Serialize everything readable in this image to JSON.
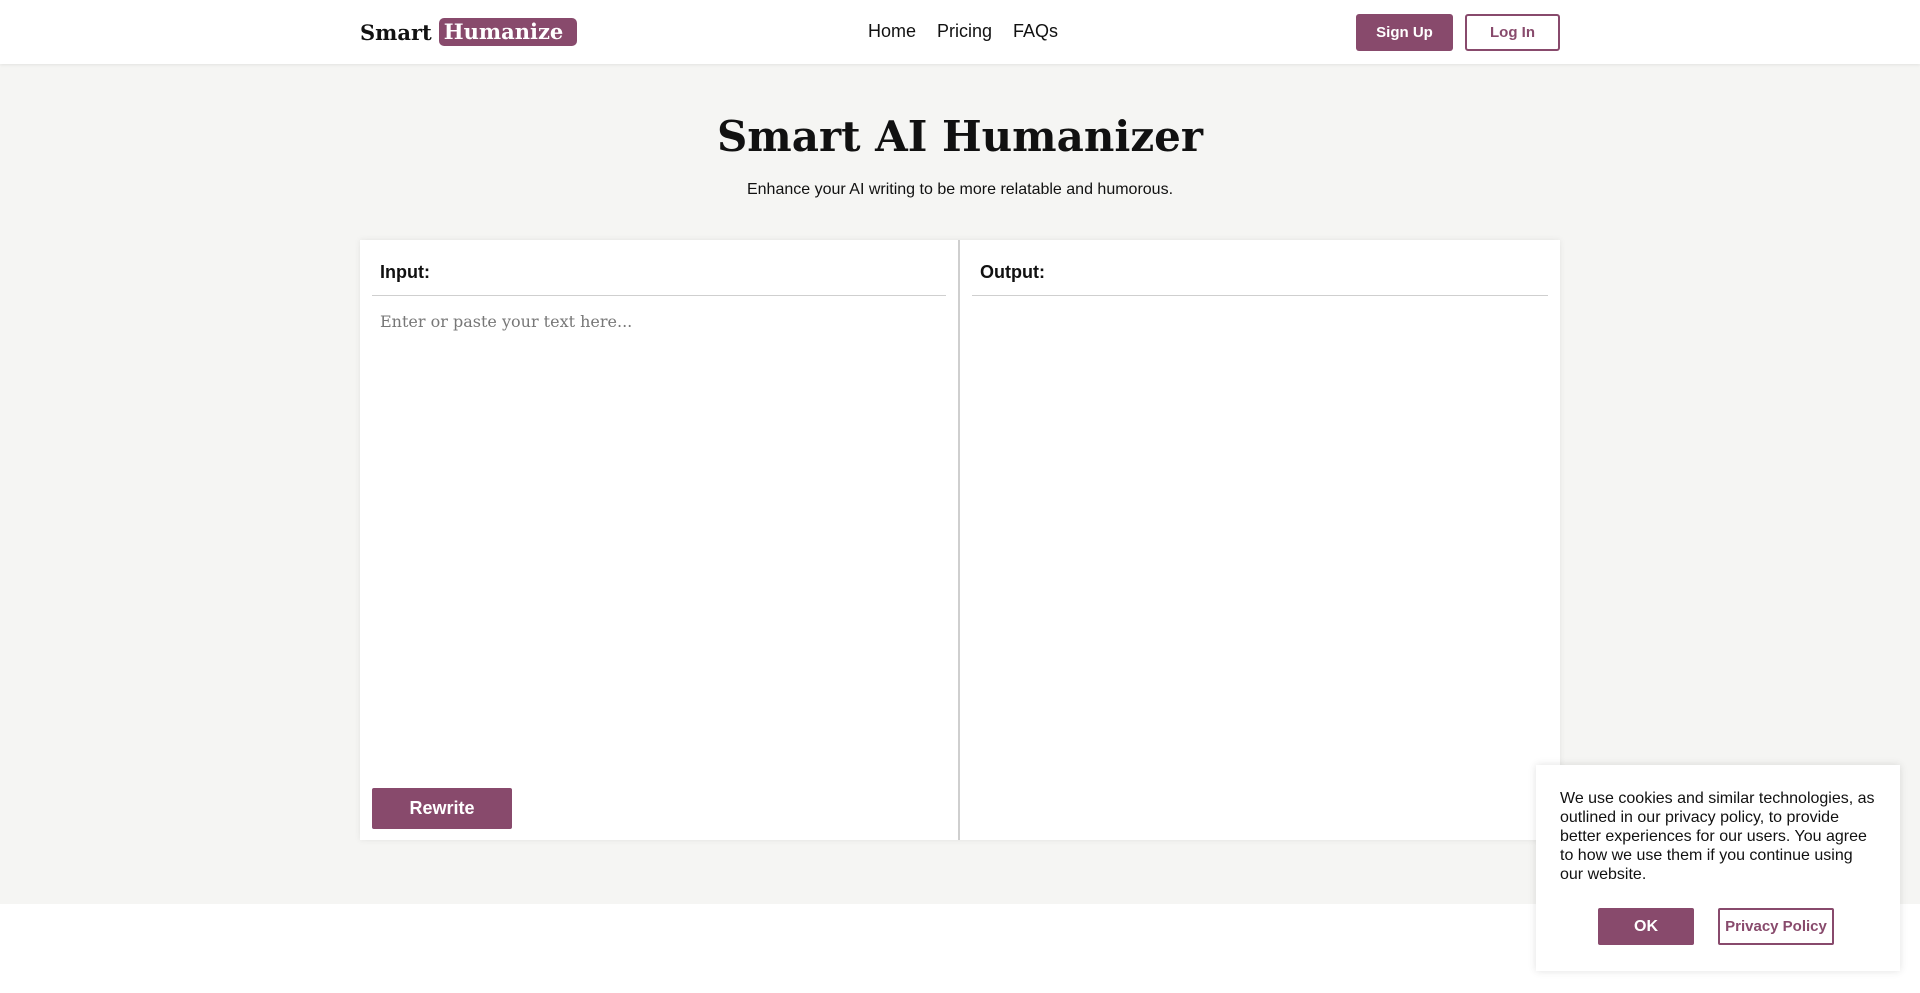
{
  "header": {
    "logo_word": "Smart",
    "logo_highlight": "Humanize",
    "nav": [
      {
        "label": "Home"
      },
      {
        "label": "Pricing"
      },
      {
        "label": "FAQs"
      }
    ],
    "signup_label": "Sign Up",
    "login_label": "Log In"
  },
  "hero": {
    "title": "Smart AI Humanizer",
    "subtitle": "Enhance your AI writing to be more relatable and humorous."
  },
  "editor": {
    "input_label": "Input:",
    "input_placeholder": "Enter or paste your text here...",
    "input_value": "",
    "output_label": "Output:",
    "output_value": "",
    "rewrite_label": "Rewrite"
  },
  "cookie": {
    "text": "We use cookies and similar technologies, as outlined in our privacy policy, to provide better experiences for our users. You agree to how we use them if you continue using our website.",
    "ok_label": "OK",
    "privacy_label": "Privacy Policy"
  },
  "colors": {
    "accent": "#884a6c",
    "background": "#f5f5f3",
    "surface": "#ffffff"
  }
}
